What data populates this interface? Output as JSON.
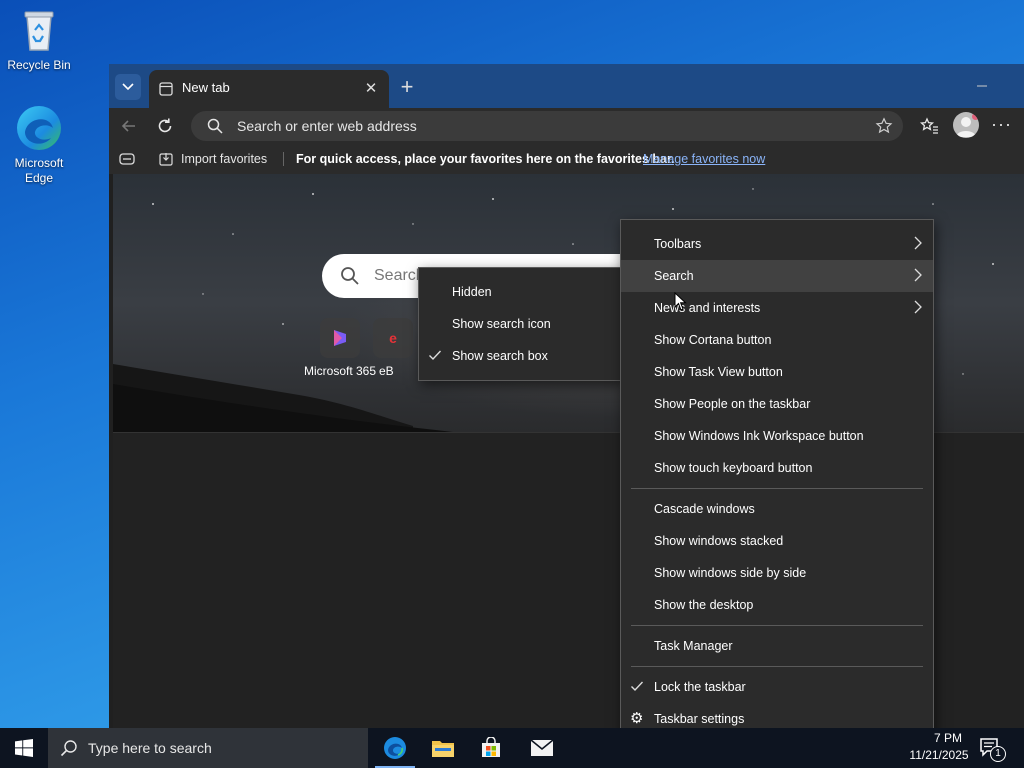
{
  "desktop": {
    "icons": [
      {
        "label": "Recycle Bin",
        "icon": "recycle-bin-icon"
      },
      {
        "label": "Microsoft Edge",
        "icon": "edge-icon"
      }
    ]
  },
  "browser": {
    "tab_title": "New tab",
    "address_placeholder": "Search or enter web address",
    "favbar": {
      "import_label": "Import favorites",
      "message": "For quick access, place your favorites here on the favorites bar.",
      "manage_link": "Manage favorites now"
    },
    "ntp": {
      "search_placeholder": "Search",
      "tiles": [
        {
          "label": "Microsoft 365"
        },
        {
          "label": "eB"
        }
      ]
    }
  },
  "taskbar_menu": {
    "groups": [
      [
        {
          "label": "Toolbars",
          "submenu": true
        },
        {
          "label": "Search",
          "submenu": true,
          "highlighted": true
        },
        {
          "label": "News and interests",
          "submenu": true
        },
        {
          "label": "Show Cortana button"
        },
        {
          "label": "Show Task View button"
        },
        {
          "label": "Show People on the taskbar"
        },
        {
          "label": "Show Windows Ink Workspace button"
        },
        {
          "label": "Show touch keyboard button"
        }
      ],
      [
        {
          "label": "Cascade windows"
        },
        {
          "label": "Show windows stacked"
        },
        {
          "label": "Show windows side by side"
        },
        {
          "label": "Show the desktop"
        }
      ],
      [
        {
          "label": "Task Manager"
        }
      ],
      [
        {
          "label": "Lock the taskbar",
          "checked": true
        },
        {
          "label": "Taskbar settings",
          "icon": "gear-icon"
        }
      ]
    ]
  },
  "search_submenu": [
    {
      "label": "Hidden",
      "checked": false
    },
    {
      "label": "Show search icon",
      "checked": false
    },
    {
      "label": "Show search box",
      "checked": true
    }
  ],
  "taskbar": {
    "search_placeholder": "Type here to search",
    "time": "7 PM",
    "date": "11/21/2025",
    "notification_count": "1"
  },
  "colors": {
    "accent": "#3a8ee6",
    "menu_bg": "#2b2b2b",
    "link": "#8ab4f8"
  }
}
